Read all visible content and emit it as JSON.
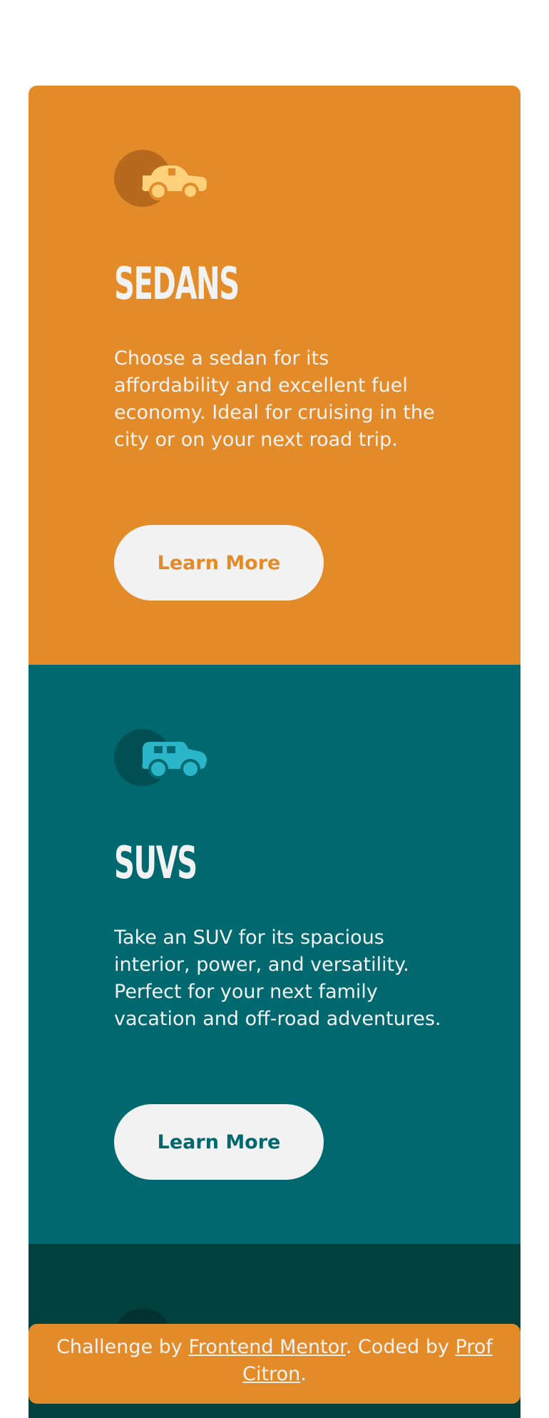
{
  "cards": [
    {
      "icon": "sedan-car-icon",
      "title": "SEDANS",
      "text": "Choose a sedan for its affordability and excellent fuel economy. Ideal for cruising in the city or on your next road trip.",
      "button_label": "Learn More",
      "colors": {
        "background": "#e28b28",
        "icon_circle": "#b7691d",
        "icon_car": "#ffd17a"
      }
    },
    {
      "icon": "suv-car-icon",
      "title": "SUVS",
      "text": "Take an SUV for its spacious interior, power, and versatility. Perfect for your next family vacation and off-road adventures.",
      "button_label": "Learn More",
      "colors": {
        "background": "#006970",
        "icon_circle": "#004f53",
        "icon_car": "#2bb5c8"
      }
    },
    {
      "icon": "luxury-car-icon",
      "colors": {
        "background": "#004140",
        "icon_circle": "#003231"
      }
    }
  ],
  "attribution": {
    "prefix": "Challenge by ",
    "link1": "Frontend Mentor",
    "middle": ". Coded by ",
    "link2": "Prof Citron",
    "suffix": ".",
    "colors": {
      "background": "#e28b28",
      "text": "#f2f2f2"
    }
  }
}
